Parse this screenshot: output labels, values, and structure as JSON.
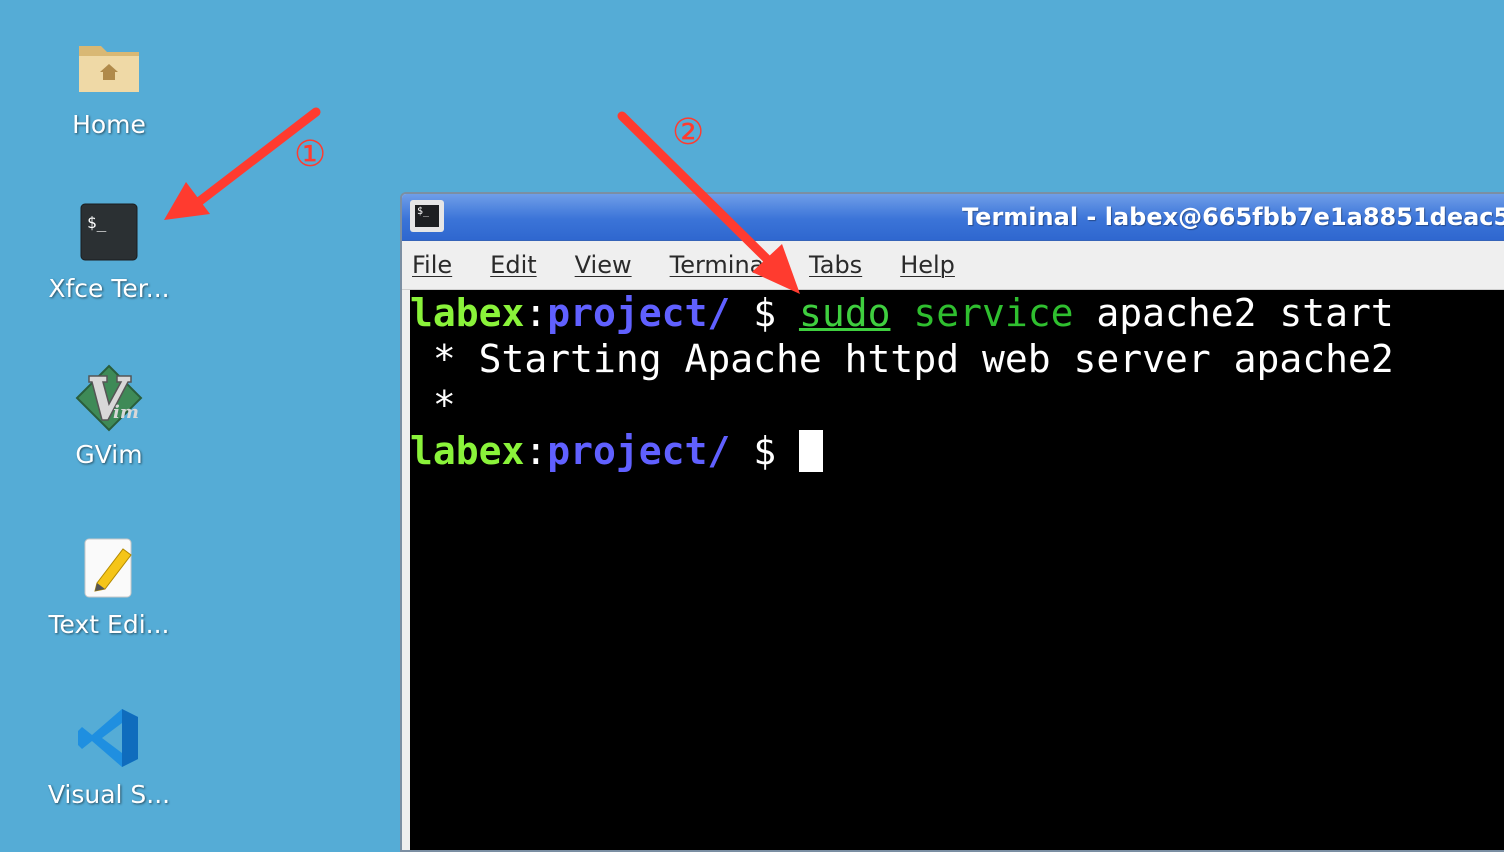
{
  "desktop": {
    "icons": [
      {
        "label": "Home",
        "icon": "home-folder-icon"
      },
      {
        "label": "Xfce Ter...",
        "icon": "terminal-icon"
      },
      {
        "label": "GVim",
        "icon": "gvim-icon"
      },
      {
        "label": "Text Edi...",
        "icon": "text-editor-icon"
      },
      {
        "label": "Visual S...",
        "icon": "vscode-icon"
      }
    ]
  },
  "annotations": {
    "step1": "①",
    "step2": "②",
    "arrow_color": "#ff3b2f"
  },
  "window": {
    "title": "Terminal - labex@665fbb7e1a8851deac5",
    "app_icon_text": "$_",
    "menu": [
      "File",
      "Edit",
      "View",
      "Terminal",
      "Tabs",
      "Help"
    ]
  },
  "terminal": {
    "prompt_user": "labex",
    "prompt_sep": ":",
    "prompt_path": "project/",
    "prompt_symbol": " $ ",
    "command_word": "sudo",
    "command_arg1": "service",
    "command_rest": " apache2 start",
    "output_line1": " * Starting Apache httpd web server apache2",
    "output_line2": " *",
    "colors": {
      "user": "#8af33a",
      "path": "#6060ff",
      "command": "#3fcf3f",
      "background": "#000000"
    }
  }
}
